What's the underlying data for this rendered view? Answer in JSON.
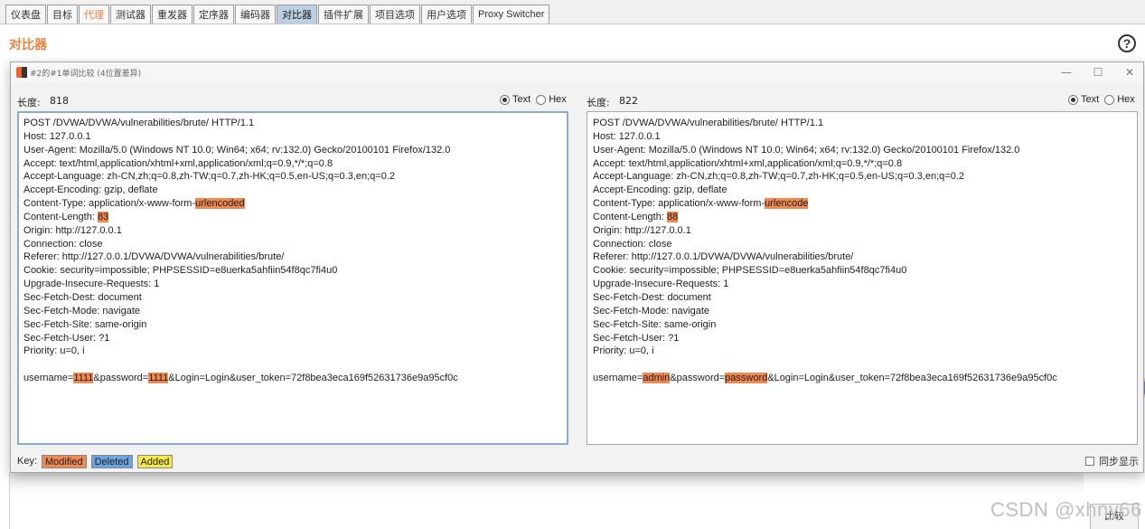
{
  "tabs": [
    {
      "label": "仪表盘",
      "state": "normal"
    },
    {
      "label": "目标",
      "state": "normal"
    },
    {
      "label": "代理",
      "state": "highlight"
    },
    {
      "label": "测试器",
      "state": "normal"
    },
    {
      "label": "重发器",
      "state": "normal"
    },
    {
      "label": "定序器",
      "state": "normal"
    },
    {
      "label": "编码器",
      "state": "normal"
    },
    {
      "label": "对比器",
      "state": "active"
    },
    {
      "label": "插件扩展",
      "state": "normal"
    },
    {
      "label": "项目选项",
      "state": "normal"
    },
    {
      "label": "用户选项",
      "state": "normal"
    },
    {
      "label": "Proxy Switcher",
      "state": "normal"
    }
  ],
  "background": {
    "title": "对比器",
    "help": "?",
    "compare_button": "比较",
    "watermark": "CSDN @xhny66"
  },
  "dialog": {
    "title": "#2的#1单词比较 (4位置差异)",
    "minimize": "—",
    "maximize": "☐",
    "close": "✕",
    "length_label": "长度:",
    "text_option": "Text",
    "hex_option": "Hex",
    "key_label": "Key:",
    "key_modified": "Modified",
    "key_deleted": "Deleted",
    "key_added": "Added",
    "sync_label": "同步显示",
    "sync_checked": false,
    "left": {
      "length": "818",
      "view": "Text",
      "lines": [
        [
          {
            "t": "POST /DVWA/DVWA/vulnerabilities/brute/ HTTP/1.1"
          }
        ],
        [
          {
            "t": "Host: 127.0.0.1"
          }
        ],
        [
          {
            "t": "User-Agent: Mozilla/5.0 (Windows NT 10.0; Win64; x64; rv:132.0) Gecko/20100101 Firefox/132.0"
          }
        ],
        [
          {
            "t": "Accept: text/html,application/xhtml+xml,application/xml;q=0.9,*/*;q=0.8"
          }
        ],
        [
          {
            "t": "Accept-Language: zh-CN,zh;q=0.8,zh-TW;q=0.7,zh-HK;q=0.5,en-US;q=0.3,en;q=0.2"
          }
        ],
        [
          {
            "t": "Accept-Encoding: gzip, deflate"
          }
        ],
        [
          {
            "t": "Content-Type: application/x-www-form-"
          },
          {
            "t": "urlencoded",
            "hl": "mod"
          }
        ],
        [
          {
            "t": "Content-Length: "
          },
          {
            "t": "83",
            "hl": "mod"
          }
        ],
        [
          {
            "t": "Origin: http://127.0.0.1"
          }
        ],
        [
          {
            "t": "Connection: close"
          }
        ],
        [
          {
            "t": "Referer: http://127.0.0.1/DVWA/DVWA/vulnerabilities/brute/"
          }
        ],
        [
          {
            "t": "Cookie: security=impossible; PHPSESSID=e8uerka5ahfiin54f8qc7fi4u0"
          }
        ],
        [
          {
            "t": "Upgrade-Insecure-Requests: 1"
          }
        ],
        [
          {
            "t": "Sec-Fetch-Dest: document"
          }
        ],
        [
          {
            "t": "Sec-Fetch-Mode: navigate"
          }
        ],
        [
          {
            "t": "Sec-Fetch-Site: same-origin"
          }
        ],
        [
          {
            "t": "Sec-Fetch-User: ?1"
          }
        ],
        [
          {
            "t": "Priority: u=0, i"
          }
        ],
        [
          {
            "t": ""
          }
        ],
        [
          {
            "t": "username="
          },
          {
            "t": "1111",
            "hl": "mod"
          },
          {
            "t": "&password="
          },
          {
            "t": "1111",
            "hl": "mod"
          },
          {
            "t": "&Login=Login&user_token=72f8bea3eca169f52631736e9a95cf0c"
          }
        ]
      ]
    },
    "right": {
      "length": "822",
      "view": "Text",
      "lines": [
        [
          {
            "t": "POST /DVWA/DVWA/vulnerabilities/brute/ HTTP/1.1"
          }
        ],
        [
          {
            "t": "Host: 127.0.0.1"
          }
        ],
        [
          {
            "t": "User-Agent: Mozilla/5.0 (Windows NT 10.0; Win64; x64; rv:132.0) Gecko/20100101 Firefox/132.0"
          }
        ],
        [
          {
            "t": "Accept: text/html,application/xhtml+xml,application/xml;q=0.9,*/*;q=0.8"
          }
        ],
        [
          {
            "t": "Accept-Language: zh-CN,zh;q=0.8,zh-TW;q=0.7,zh-HK;q=0.5,en-US;q=0.3,en;q=0.2"
          }
        ],
        [
          {
            "t": "Accept-Encoding: gzip, deflate"
          }
        ],
        [
          {
            "t": "Content-Type: application/x-www-form-"
          },
          {
            "t": "urlencode",
            "hl": "mod"
          }
        ],
        [
          {
            "t": "Content-Length: "
          },
          {
            "t": "88",
            "hl": "mod"
          }
        ],
        [
          {
            "t": "Origin: http://127.0.0.1"
          }
        ],
        [
          {
            "t": "Connection: close"
          }
        ],
        [
          {
            "t": "Referer: http://127.0.0.1/DVWA/DVWA/vulnerabilities/brute/"
          }
        ],
        [
          {
            "t": "Cookie: security=impossible; PHPSESSID=e8uerka5ahfiin54f8qc7fi4u0"
          }
        ],
        [
          {
            "t": "Upgrade-Insecure-Requests: 1"
          }
        ],
        [
          {
            "t": "Sec-Fetch-Dest: document"
          }
        ],
        [
          {
            "t": "Sec-Fetch-Mode: navigate"
          }
        ],
        [
          {
            "t": "Sec-Fetch-Site: same-origin"
          }
        ],
        [
          {
            "t": "Sec-Fetch-User: ?1"
          }
        ],
        [
          {
            "t": "Priority: u=0, i"
          }
        ],
        [
          {
            "t": ""
          }
        ],
        [
          {
            "t": "username="
          },
          {
            "t": "admin",
            "hl": "mod"
          },
          {
            "t": "&password="
          },
          {
            "t": "password",
            "hl": "mod"
          },
          {
            "t": "&Login=Login&user_token=72f8bea3eca169f52631736e9a95cf0c"
          }
        ]
      ]
    }
  },
  "icons": {
    "app_icon": "burp-logo-icon",
    "help_icon": "help-circle-icon",
    "floating": "assistant-logo-icon"
  }
}
